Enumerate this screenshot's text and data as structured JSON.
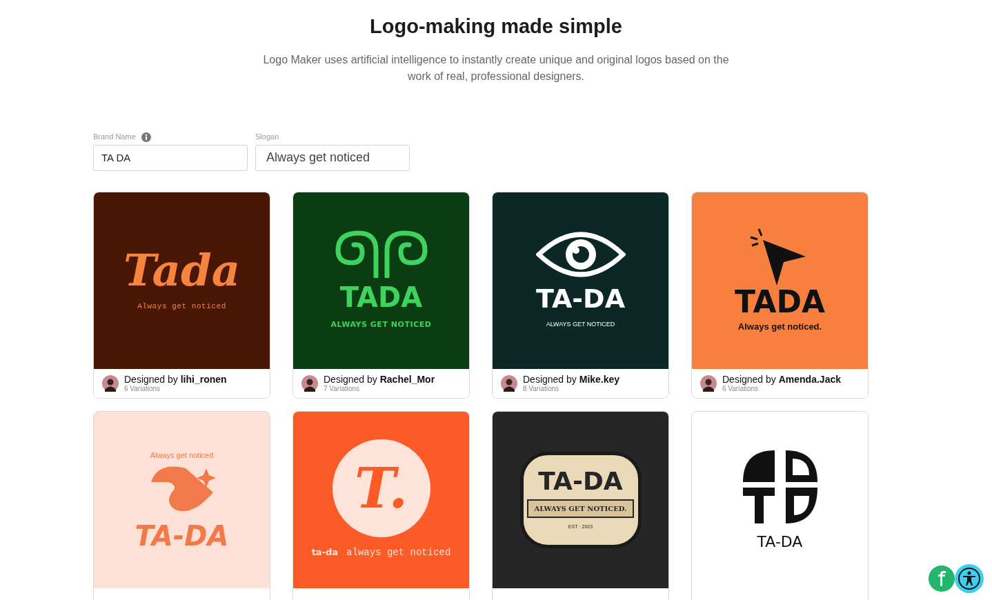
{
  "title": "Logo-making made simple",
  "subtitle": "Logo Maker uses artificial intelligence to instantly create unique and original logos based on the work of real, professional designers.",
  "fields": [
    {
      "label": "Brand Name",
      "info": true,
      "value": "TA DA"
    },
    {
      "label": "Slogan",
      "info": false,
      "value": "Always get noticed"
    }
  ],
  "cards": [
    {
      "kind": "script",
      "color": "#4a1606",
      "name": "Tada",
      "slogan": "Always get noticed",
      "designer_prefix": "Designed by",
      "designer": "lihi_ronen",
      "variations": "6 Variations"
    },
    {
      "kind": "swirl",
      "color": "#0b3d12",
      "name": "TADA",
      "slogan": "ALWAYS GET NOTICED",
      "designer_prefix": "Designed by",
      "designer": "Rachel_Mor",
      "variations": "7 Variations"
    },
    {
      "kind": "eye",
      "color": "#0b2826",
      "name": "TA-DA",
      "slogan": "ALWAYS GET NOTICED",
      "designer_prefix": "Designed by",
      "designer": "Mike.key",
      "variations": "8 Variations"
    },
    {
      "kind": "cursor",
      "color": "#f8803f",
      "name": "TADA",
      "slogan": "Always get noticed.",
      "designer_prefix": "Designed by",
      "designer": "Amenda.Jack",
      "variations": "6 Variations"
    },
    {
      "kind": "rocket",
      "color": "#fde1d6",
      "name": "TA-DA",
      "slogan": "Always get noticed"
    },
    {
      "kind": "badge",
      "color": "#fc5a27",
      "name": "T.",
      "tag": "ta-da",
      "slogan": "always get noticed"
    },
    {
      "kind": "shield",
      "color": "#262626",
      "name": "TA-DA",
      "slogan": "ALWAYS GET NOTICED.",
      "tag": "EST · 2023"
    },
    {
      "kind": "monogram",
      "color": "#ffffff",
      "name": "TA-DA"
    }
  ]
}
